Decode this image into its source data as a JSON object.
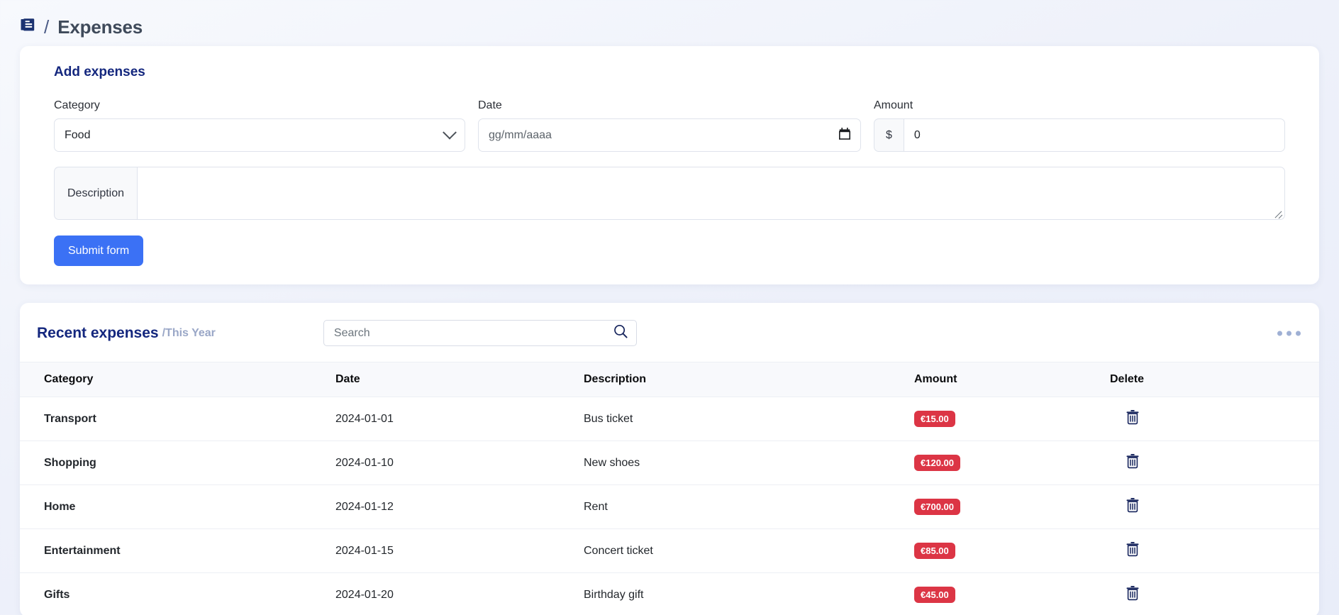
{
  "header": {
    "icon": "ledger-icon",
    "separator": "/",
    "title": "Expenses"
  },
  "form": {
    "card_title": "Add expenses",
    "category": {
      "label": "Category",
      "value": "Food",
      "icon": "chevron-down-icon"
    },
    "date": {
      "label": "Date",
      "placeholder": "gg/mm/aaaa",
      "value": "",
      "icon": "calendar-icon"
    },
    "amount": {
      "label": "Amount",
      "prefix": "$",
      "value": "0"
    },
    "description": {
      "label": "Description",
      "value": ""
    },
    "submit_label": "Submit form",
    "submit_color": "#3b71f5"
  },
  "recent": {
    "title": "Recent expenses",
    "subtitle": "/This Year",
    "search_placeholder": "Search",
    "search_value": "",
    "search_icon": "search-icon",
    "menu_icon": "ellipsis-icon",
    "columns": [
      "Category",
      "Date",
      "Description",
      "Amount",
      "Delete"
    ],
    "badge_color": "#dc3545",
    "rows": [
      {
        "category": "Transport",
        "date": "2024-01-01",
        "description": "Bus ticket",
        "amount": "€15.00"
      },
      {
        "category": "Shopping",
        "date": "2024-01-10",
        "description": "New shoes",
        "amount": "€120.00"
      },
      {
        "category": "Home",
        "date": "2024-01-12",
        "description": "Rent",
        "amount": "€700.00"
      },
      {
        "category": "Entertainment",
        "date": "2024-01-15",
        "description": "Concert ticket",
        "amount": "€85.00"
      },
      {
        "category": "Gifts",
        "date": "2024-01-20",
        "description": "Birthday gift",
        "amount": "€45.00"
      }
    ],
    "delete_icon": "trash-icon"
  }
}
